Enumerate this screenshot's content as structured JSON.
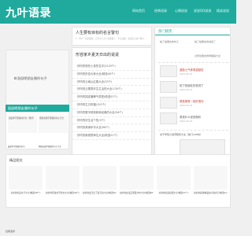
{
  "logo": "九叶语录",
  "nav": [
    "网站首页",
    "经典语录",
    "心情说说",
    "说说QQ说说",
    "搞笑说说"
  ],
  "banner": {
    "title": "人生要有目标的名言警句",
    "text": "1、男人一生必要的，它不过于点个好感情了，不认识你，知道它只是个做人..."
  },
  "left_image_alt": "鼓励晒朋友圈的句子",
  "main": {
    "title": "形容家乡夏天日出的说说",
    "items": [
      "·好听的现在小孩的名字(3129个)",
      "·好听的形容大家大全(精选40个)",
      "·好听的云南山区春大全(33个)",
      "·好听的云雪男好生生活的大全(130个)",
      "·好听的描述暴脾气类型(精选51个)",
      "·好听的生日祝福(120个)",
      "·好听的数字精英新新经典的大全(94个)",
      "·好听的好生活个性(9个)",
      "·好听的故事年华大全(96个)",
      "·好听的新感受单位大全(精选21个)"
    ]
  },
  "sidebar": {
    "head": "热门搞笑",
    "top_items": [
      "拍了拍朋友的句子",
      "拍了拍朋友的说说了"
    ],
    "top_right": "过年给朋友的祝福语大全",
    "list": [
      {
        "title": "激励士气奔勇激励性",
        "date": "2022-05-07"
      },
      {
        "title": "拍了拍朋友的说说了",
        "date": "2022-05-07"
      },
      {
        "title": "搞笑搞笑一段好语句",
        "date": "2022-05-07"
      },
      {
        "title": "男孩什么说说精彩",
        "date": "2022-05-07"
      }
    ],
    "blurb": "关于年轻人经济短暂大全（热门100句）"
  },
  "category": {
    "head": "鼓励晒朋友圈的句子",
    "items": [
      {
        "thumb": "鼓励你不服输的名句（推荐）",
        "caption": "鼓励你不服输的名句"
      },
      {
        "thumb": "晒朋友圈不服输的句子大全",
        "caption": "晒朋友圈不服输的句子大全"
      }
    ]
  },
  "section2": {
    "head": "精品图文",
    "items": [
      "好听的家庭文字大全(精选38个)",
      "好听的形容文写作文大全(精选46个)",
      "好听的生活之下爱打动大全(精选30个)",
      "好听的女生正能量分布大全(精选86个)",
      "好听的家庭和谐大全(精选37个)",
      "好听的感情唯美的心情文字(精选21个)"
    ]
  },
  "footer": "经典语录"
}
